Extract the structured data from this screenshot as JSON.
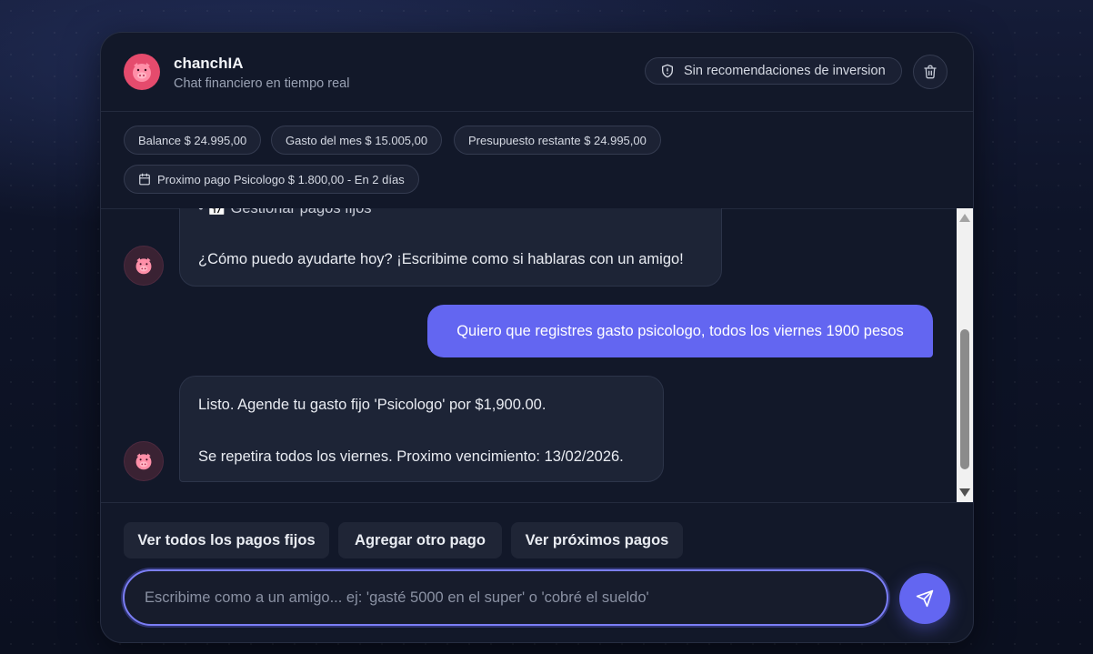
{
  "header": {
    "title": "chanchIA",
    "subtitle": "Chat financiero en tiempo real",
    "disclaimer": "Sin recomendaciones de inversion",
    "clear_icon": "trash-icon"
  },
  "stats": {
    "balance": "Balance $ 24.995,00",
    "month_spend": "Gasto del mes $ 15.005,00",
    "remaining_budget": "Presupuesto restante $ 24.995,00",
    "next_payment": "Proximo pago Psicologo $ 1.800,00 - En 2 días"
  },
  "messages": {
    "bot_1_partial": "• 📅 Gestionar pagos fijos",
    "bot_1_text": "¿Cómo puedo ayudarte hoy? ¡Escribime como si hablaras con un amigo!",
    "user_1": "Quiero que registres gasto psicologo, todos los viernes 1900 pesos",
    "bot_2_line_1": "Listo. Agende tu gasto fijo 'Psicologo' por $1,900.00.",
    "bot_2_line_2": "Se repetira todos los viernes. Proximo vencimiento: 13/02/2026."
  },
  "quick_replies": {
    "view_all": "Ver todos los pagos fijos",
    "add_other": "Agregar otro pago",
    "view_upcoming": "Ver próximos pagos"
  },
  "composer": {
    "placeholder": "Escribime como a un amigo... ej: 'gasté 5000 en el super' o 'cobré el sueldo'",
    "value": ""
  },
  "colors": {
    "accent": "#6366f1",
    "brand_pink": "#e54b6d",
    "card_bg": "#121829"
  }
}
